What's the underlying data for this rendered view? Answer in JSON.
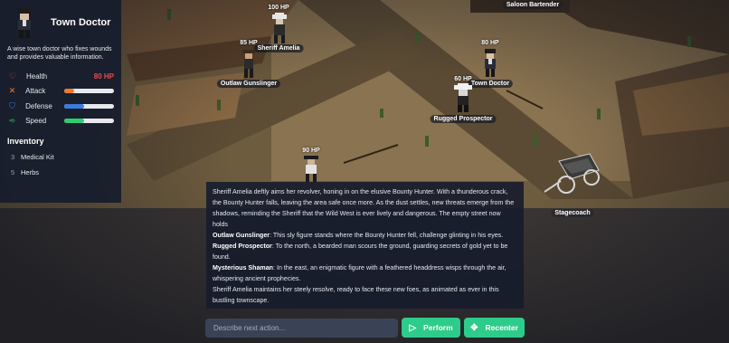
{
  "character": {
    "name": "Town Doctor",
    "description": "A wise town doctor who fixes wounds and provides valuable information.",
    "stats": {
      "health": {
        "label": "Health",
        "value_text": "80 HP",
        "icon": "heart-icon",
        "color": "#e74c4c"
      },
      "attack": {
        "label": "Attack",
        "level": 0.2,
        "icon": "crossed-swords-icon",
        "color": "#f07a2a"
      },
      "defense": {
        "label": "Defense",
        "level": 0.4,
        "icon": "shield-icon",
        "color": "#3b7be0"
      },
      "speed": {
        "label": "Speed",
        "level": 0.4,
        "icon": "running-icon",
        "color": "#2ecc71"
      }
    }
  },
  "inventory": {
    "title": "Inventory",
    "items": [
      {
        "qty": "3",
        "name": "Medical Kit"
      },
      {
        "qty": "5",
        "name": "Herbs"
      }
    ]
  },
  "npcs": {
    "sheriff": {
      "hp": "100 HP",
      "name": "Sheriff Amelia"
    },
    "gunslinger": {
      "hp": "85 HP",
      "name": "Outlaw Gunslinger"
    },
    "doctor": {
      "hp": "80 HP",
      "name": "Town Doctor"
    },
    "prospector": {
      "hp": "60 HP",
      "name": "Rugged Prospector"
    },
    "bounty": {
      "hp": "90 HP"
    },
    "bartender": {
      "name": "Saloon Bartender"
    },
    "stagecoach": {
      "name": "Stagecoach"
    }
  },
  "narration": {
    "intro": "Sheriff Amelia deftly aims her revolver, honing in on the elusive Bounty Hunter. With a thunderous crack, the Bounty Hunter falls, leaving the area safe once more. As the dust settles, new threats emerge from the shadows, reminding the Sheriff that the Wild West is ever lively and dangerous. The empty street now holds",
    "entries": [
      {
        "name": "Outlaw Gunslinger",
        "text": ": This sly figure stands where the Bounty Hunter fell, challenge glinting in his eyes."
      },
      {
        "name": "Rugged Prospector",
        "text": ": To the north, a bearded man scours the ground, guarding secrets of gold yet to be found."
      },
      {
        "name": "Mysterious Shaman",
        "text": ": In the east, an enigmatic figure with a feathered headdress wisps through the air, whispering ancient prophecies."
      }
    ],
    "outro": "Sheriff Amelia maintains her steely resolve, ready to face these new foes, as animated as ever in this bustling townscape."
  },
  "actions": {
    "input_placeholder": "Describe next action...",
    "perform_label": "Perform",
    "recenter_label": "Recenter",
    "accent": "#2ecc8a"
  }
}
